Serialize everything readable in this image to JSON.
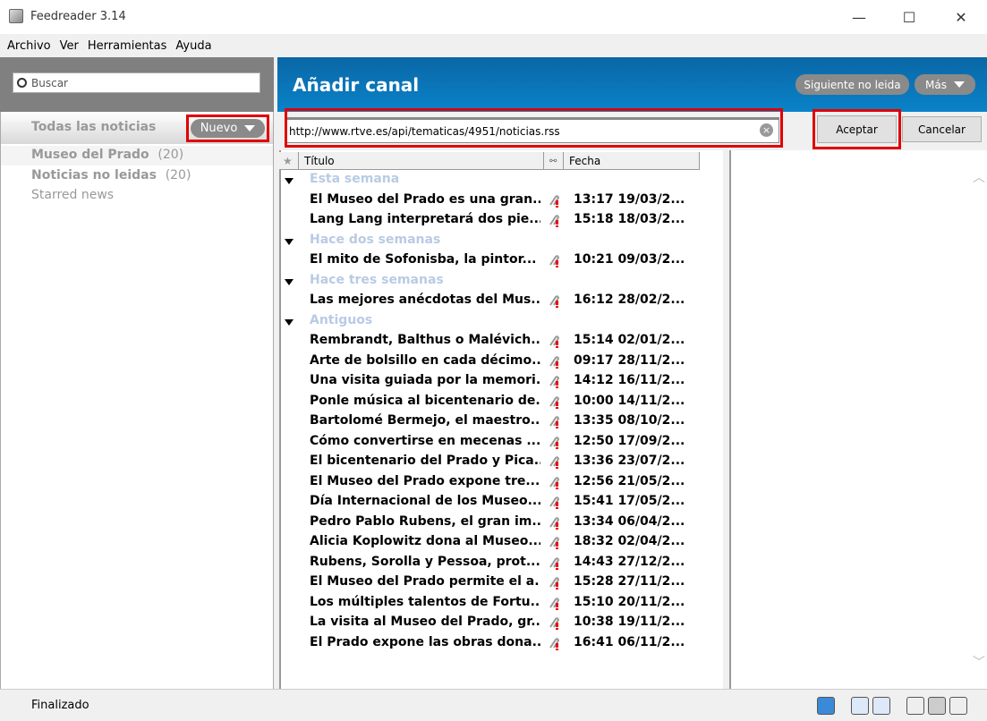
{
  "window": {
    "title": "Feedreader 3.14",
    "minimize": "—",
    "maximize": "☐",
    "close": "✕"
  },
  "menu": [
    "Archivo",
    "Ver",
    "Herramientas",
    "Ayuda"
  ],
  "sidebar": {
    "search_placeholder": "Buscar",
    "all_news": "Todas las noticias",
    "new_button": "Nuevo",
    "feeds": [
      {
        "name": "Museo del Prado",
        "count": "(20)"
      },
      {
        "name": "Noticias no leidas",
        "count": "(20)"
      },
      {
        "name": "Starred news",
        "count": ""
      }
    ]
  },
  "header": {
    "title": "Añadir canal",
    "next_unread": "Siguiente no leida",
    "more": "Más"
  },
  "add_feed": {
    "url": "http://www.rtve.es/api/tematicas/4951/noticias.rss",
    "accept": "Aceptar",
    "cancel": "Cancelar"
  },
  "list": {
    "columns": {
      "star": "★",
      "title": "Título",
      "date": "Fecha"
    },
    "groups": [
      {
        "label": "Esta semana",
        "items": [
          {
            "title": "El Museo del Prado es una gran...",
            "date": "13:17 19/03/2..."
          },
          {
            "title": "Lang Lang interpretará dos pie...",
            "date": "15:18 18/03/2..."
          }
        ]
      },
      {
        "label": "Hace dos semanas",
        "items": [
          {
            "title": "El mito de Sofonisba, la pintor...",
            "date": "10:21 09/03/2..."
          }
        ]
      },
      {
        "label": "Hace tres semanas",
        "items": [
          {
            "title": "Las mejores anécdotas del Mus...",
            "date": "16:12 28/02/2..."
          }
        ]
      },
      {
        "label": "Antiguos",
        "items": [
          {
            "title": "Rembrandt, Balthus o Malévich...",
            "date": "15:14 02/01/2..."
          },
          {
            "title": "Arte de bolsillo en cada décimo...",
            "date": "09:17 28/11/2..."
          },
          {
            "title": "Una visita guiada por la memori...",
            "date": "14:12 16/11/2..."
          },
          {
            "title": "Ponle música al bicentenario de...",
            "date": "10:00 14/11/2..."
          },
          {
            "title": "Bartolomé Bermejo, el maestro...",
            "date": "13:35 08/10/2..."
          },
          {
            "title": "Cómo convertirse en mecenas ...",
            "date": "12:50 17/09/2..."
          },
          {
            "title": "El bicentenario del Prado y Pica...",
            "date": "13:36 23/07/2..."
          },
          {
            "title": "El Museo del Prado expone tre...",
            "date": "12:56 21/05/2..."
          },
          {
            "title": "Día Internacional de los Museo...",
            "date": "15:41 17/05/2..."
          },
          {
            "title": "Pedro Pablo Rubens, el gran im...",
            "date": "13:34 06/04/2..."
          },
          {
            "title": "Alicia Koplowitz dona al Museo...",
            "date": "18:32 02/04/2..."
          },
          {
            "title": "Rubens, Sorolla y Pessoa, prot...",
            "date": "14:43 27/12/2..."
          },
          {
            "title": "El Museo del Prado permite el a...",
            "date": "15:28 27/11/2..."
          },
          {
            "title": "Los múltiples talentos de Fortu...",
            "date": "15:10 20/11/2..."
          },
          {
            "title": "La visita al Museo del Prado, gr...",
            "date": "10:38 19/11/2..."
          },
          {
            "title": "El Prado expone las obras dona...",
            "date": "16:41 06/11/2..."
          }
        ]
      }
    ]
  },
  "status": {
    "text": "Finalizado"
  },
  "colors": {
    "header_blue": "#0a78bc",
    "highlight_red": "#e00000",
    "group_label": "#b8cbe4"
  }
}
